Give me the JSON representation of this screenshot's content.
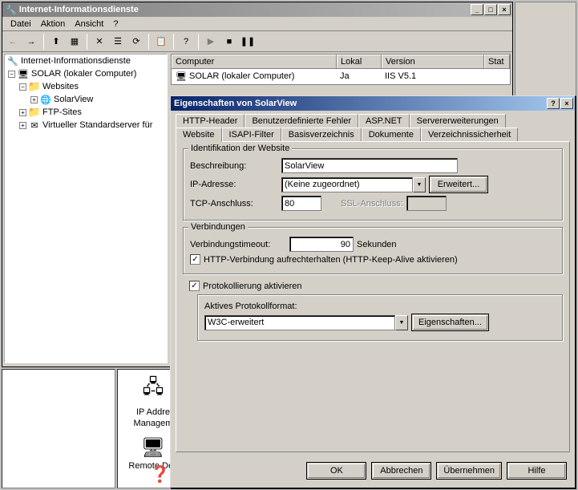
{
  "main_window": {
    "title": "Internet-Informationsdienste",
    "menu": [
      "Datei",
      "Aktion",
      "Ansicht",
      "?"
    ],
    "tree": {
      "root": "Internet-Informationsdienste",
      "server": "SOLAR (lokaler Computer)",
      "websites": "Websites",
      "solarview": "SolarView",
      "ftp": "FTP-Sites",
      "smtp": "Virtueller Standardserver für"
    },
    "list_headers": {
      "computer": "Computer",
      "lokal": "Lokal",
      "version": "Version",
      "stat": "Stat"
    },
    "list_row": {
      "computer": "SOLAR (lokaler Computer)",
      "lokal": "Ja",
      "version": "IIS V5.1",
      "stat": ""
    }
  },
  "dialog": {
    "title": "Eigenschaften von SolarView",
    "tabs_back": [
      "HTTP-Header",
      "Benutzerdefinierte Fehler",
      "ASP.NET",
      "Servererweiterungen"
    ],
    "tabs_front": [
      "Website",
      "ISAPI-Filter",
      "Basisverzeichnis",
      "Dokumente",
      "Verzeichnissicherheit"
    ],
    "group_ident": "Identifikation der Website",
    "desc_label": "Beschreibung:",
    "desc_value": "SolarView",
    "ip_label": "IP-Adresse:",
    "ip_value": "(Keine zugeordnet)",
    "erweitert": "Erweitert...",
    "tcp_label": "TCP-Anschluss:",
    "tcp_value": "80",
    "ssl_label": "SSL-Anschluss:",
    "group_conn": "Verbindungen",
    "timeout_label": "Verbindungstimeout:",
    "timeout_value": "90",
    "timeout_unit": "Sekunden",
    "keepalive": "HTTP-Verbindung aufrechterhalten (HTTP-Keep-Alive aktivieren)",
    "logging_check": "Protokollierung aktivieren",
    "logging_format_label": "Aktives Protokollformat:",
    "logging_format_value": "W3C-erweitert",
    "properties_btn": "Eigenschaften...",
    "buttons": {
      "ok": "OK",
      "cancel": "Abbrechen",
      "apply": "Übernehmen",
      "help": "Hilfe"
    }
  },
  "bottom": {
    "ip_addr": "IP Addre",
    "manage": "Managem",
    "remote": "Remote Des"
  }
}
